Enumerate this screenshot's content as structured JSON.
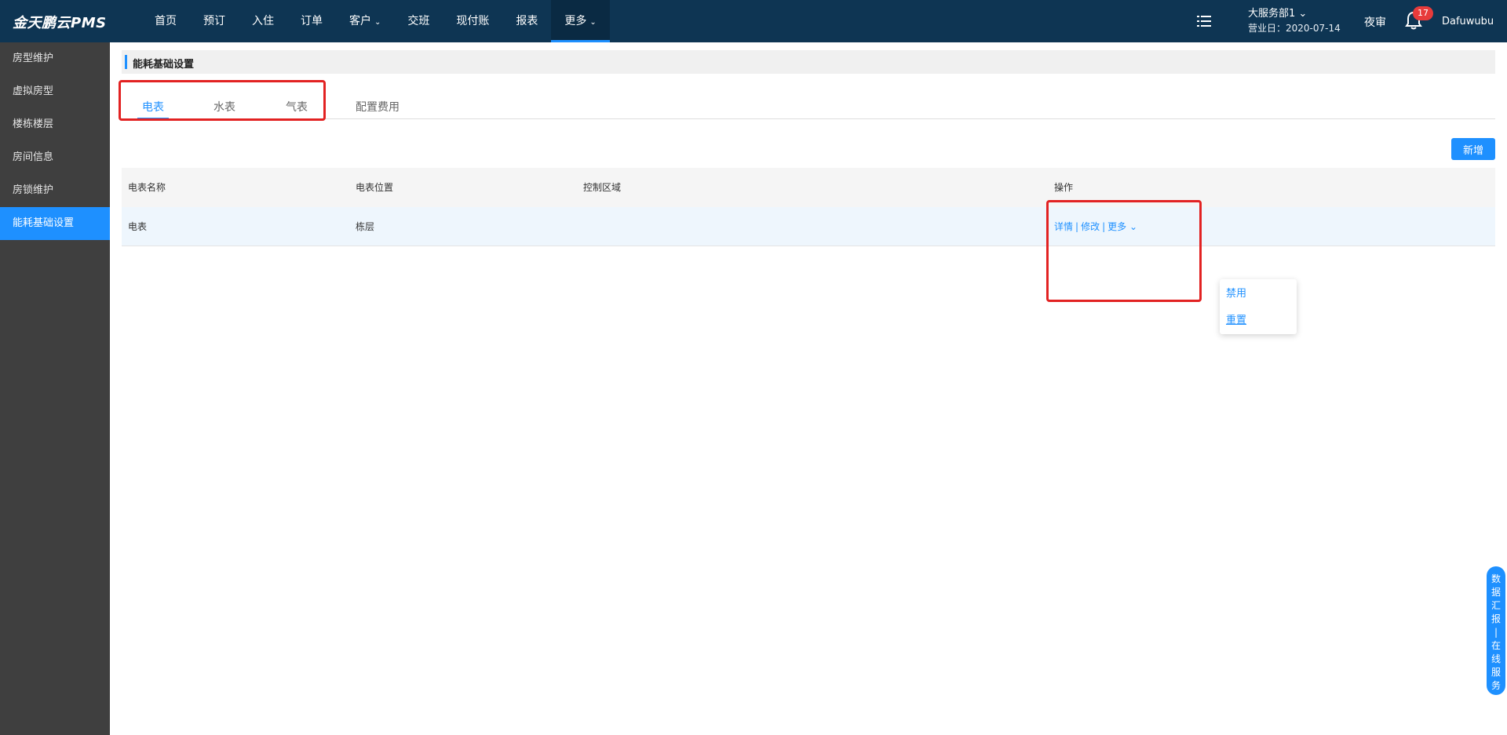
{
  "app": {
    "logo": "金天鹏云PMS"
  },
  "nav": {
    "items": [
      {
        "label": "首页",
        "caret": ""
      },
      {
        "label": "预订",
        "caret": ""
      },
      {
        "label": "入住",
        "caret": ""
      },
      {
        "label": "订单",
        "caret": ""
      },
      {
        "label": "客户",
        "caret": "⌄"
      },
      {
        "label": "交班",
        "caret": ""
      },
      {
        "label": "现付账",
        "caret": ""
      },
      {
        "label": "报表",
        "caret": ""
      },
      {
        "label": "更多",
        "caret": "⌄"
      }
    ],
    "active_index": 8
  },
  "header": {
    "dept": "大服务部1 ⌄",
    "business_date": "营业日：2020-07-14",
    "night_audit": "夜审",
    "notifications": "17",
    "username": "Dafuwubu"
  },
  "sidebar": {
    "items": [
      {
        "label": "房型维护"
      },
      {
        "label": "虚拟房型"
      },
      {
        "label": "楼栋楼层"
      },
      {
        "label": "房间信息"
      },
      {
        "label": "房锁维护"
      },
      {
        "label": "能耗基础设置"
      }
    ],
    "active_index": 5
  },
  "page": {
    "title": "能耗基础设置",
    "tabs": [
      {
        "label": "电表"
      },
      {
        "label": "水表"
      },
      {
        "label": "气表"
      },
      {
        "label": "配置费用"
      }
    ],
    "active_tab": 0,
    "add_button": "新增"
  },
  "table": {
    "headers": [
      "电表名称",
      "电表位置",
      "控制区域",
      "操作"
    ],
    "rows": [
      {
        "name": "电表",
        "location": "栋层",
        "area": ""
      }
    ],
    "actions": {
      "detail": "详情",
      "edit": "修改",
      "more": "更多 ⌄",
      "sep": "|"
    },
    "more_menu": [
      "禁用",
      "重置"
    ]
  },
  "float_service": [
    "数",
    "据",
    "汇",
    "报",
    "|",
    "在",
    "线",
    "服",
    "务"
  ],
  "colors": {
    "topbar": "#0e3553",
    "sidebar": "#3f3f3f",
    "accent": "#1e90ff",
    "highlight_box": "#e22222"
  }
}
